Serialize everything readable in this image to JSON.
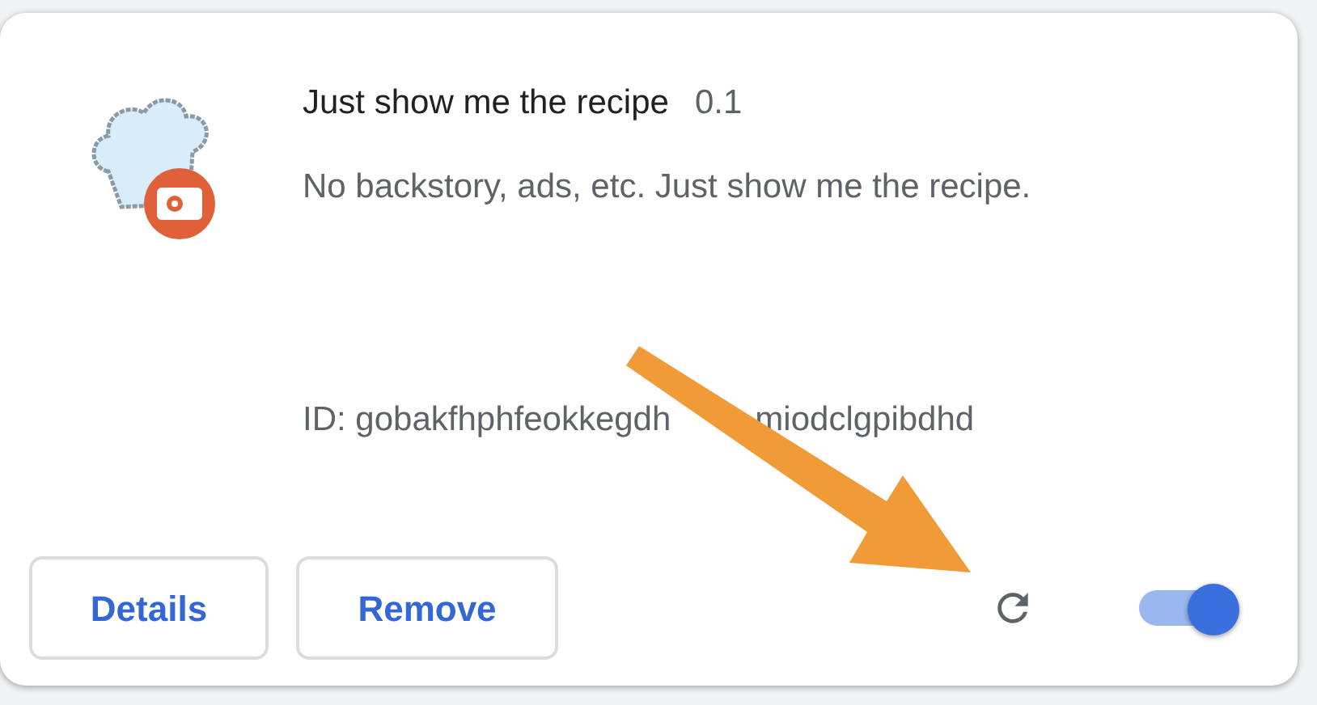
{
  "extension": {
    "name": "Just show me the recipe",
    "version": "0.1",
    "description": "No backstory, ads, etc. Just show me the recipe.",
    "id_visible_start": "ID: gobakfhphfeokkegdh",
    "id_visible_end": "miodclgpibdhd"
  },
  "buttons": [
    {
      "label": "Details"
    },
    {
      "label": "Remove"
    }
  ],
  "enable_toggle": {
    "on": true
  }
}
